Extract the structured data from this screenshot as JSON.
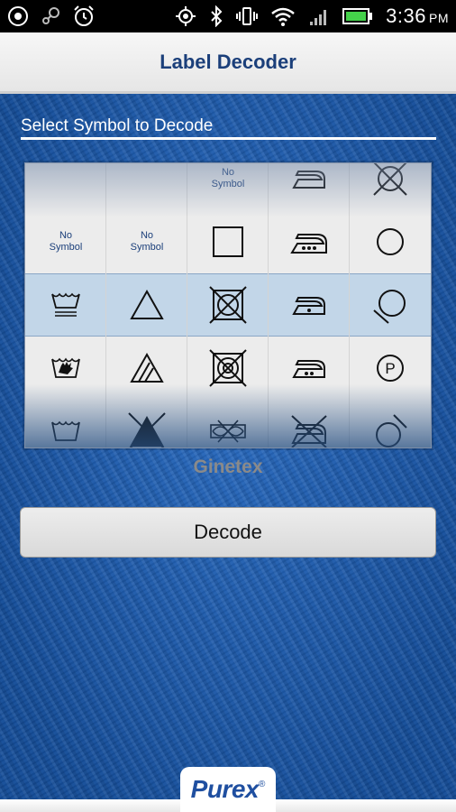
{
  "status_bar": {
    "time": "3:36",
    "ampm": "PM",
    "icons_left": [
      "target-icon",
      "steam-icon",
      "alarm-icon"
    ],
    "icons_right": [
      "gps-icon",
      "bluetooth-icon",
      "vibrate-icon",
      "wifi-icon",
      "signal-icon",
      "battery-icon"
    ]
  },
  "header": {
    "title": "Label Decoder"
  },
  "main": {
    "section_label": "Select Symbol to Decode",
    "no_symbol_text": "No\nSymbol",
    "picker": {
      "columns": [
        {
          "name": "wash",
          "cells": [
            {
              "icon": "blank"
            },
            {
              "text": "No Symbol"
            },
            {
              "icon": "wash-tub-lines-icon",
              "selected": true
            },
            {
              "icon": "hand-wash-icon"
            },
            {
              "icon": "wash-tub-icon"
            }
          ]
        },
        {
          "name": "bleach",
          "cells": [
            {
              "icon": "blank"
            },
            {
              "text": "No Symbol"
            },
            {
              "icon": "triangle-icon",
              "selected": true
            },
            {
              "icon": "non-chlorine-bleach-icon"
            },
            {
              "icon": "do-not-bleach-icon"
            }
          ]
        },
        {
          "name": "dry",
          "cells": [
            {
              "text": "No Symbol"
            },
            {
              "icon": "square-icon"
            },
            {
              "icon": "do-not-tumble-dry-icon",
              "selected": true
            },
            {
              "icon": "do-not-dry-icon"
            },
            {
              "icon": "do-not-wring-icon"
            }
          ]
        },
        {
          "name": "iron",
          "cells": [
            {
              "icon": "iron-icon"
            },
            {
              "icon": "iron-high-heat-icon"
            },
            {
              "icon": "iron-low-heat-icon",
              "selected": true
            },
            {
              "icon": "iron-medium-heat-icon"
            },
            {
              "icon": "do-not-iron-icon"
            }
          ]
        },
        {
          "name": "dry-clean",
          "cells": [
            {
              "icon": "do-not-dry-clean-x-icon"
            },
            {
              "icon": "circle-icon"
            },
            {
              "icon": "do-not-dry-clean-icon",
              "selected": true
            },
            {
              "icon": "dry-clean-p-icon"
            },
            {
              "icon": "do-not-dry-clean-icon"
            }
          ]
        }
      ],
      "p_letter": "P"
    },
    "standard_label": "Ginetex",
    "decode_button": "Decode"
  },
  "footer": {
    "logo": "Purex",
    "logo_mark": "®"
  },
  "colors": {
    "background": "#1d59a8",
    "title_text": "#1b3f7a",
    "selection": "#a0c4e6"
  }
}
